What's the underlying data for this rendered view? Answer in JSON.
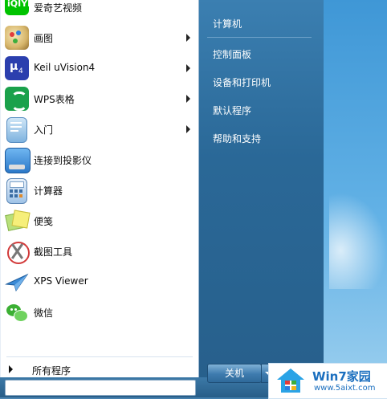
{
  "start_menu": {
    "programs": [
      {
        "label": "爱奇艺视频",
        "icon": "iqiyi-icon",
        "has_submenu": false
      },
      {
        "label": "画图",
        "icon": "paint-icon",
        "has_submenu": true
      },
      {
        "label": "Keil uVision4",
        "icon": "keil-icon",
        "has_submenu": true
      },
      {
        "label": "WPS表格",
        "icon": "wps-sheets-icon",
        "has_submenu": true
      },
      {
        "label": "入门",
        "icon": "getting-started-icon",
        "has_submenu": true
      },
      {
        "label": "连接到投影仪",
        "icon": "projector-icon",
        "has_submenu": false
      },
      {
        "label": "计算器",
        "icon": "calculator-icon",
        "has_submenu": false
      },
      {
        "label": "便笺",
        "icon": "sticky-notes-icon",
        "has_submenu": false
      },
      {
        "label": "截图工具",
        "icon": "snipping-tool-icon",
        "has_submenu": false
      },
      {
        "label": "XPS Viewer",
        "icon": "xps-viewer-icon",
        "has_submenu": false
      },
      {
        "label": "微信",
        "icon": "wechat-icon",
        "has_submenu": false
      }
    ],
    "all_programs": "所有程序",
    "right_links": [
      "计算机",
      "控制面板",
      "设备和打印机",
      "默认程序",
      "帮助和支持"
    ],
    "shutdown_label": "关机",
    "iqiyi_logo_text": "iQIYI"
  },
  "watermark": {
    "title": "Win7家园",
    "url": "www.5aixt.com"
  },
  "colors": {
    "iqiyi_green": "#00c300",
    "wps_green": "#1aa14b",
    "keil_blue": "#2b3fae",
    "accent_blue": "#1b6fbf"
  }
}
